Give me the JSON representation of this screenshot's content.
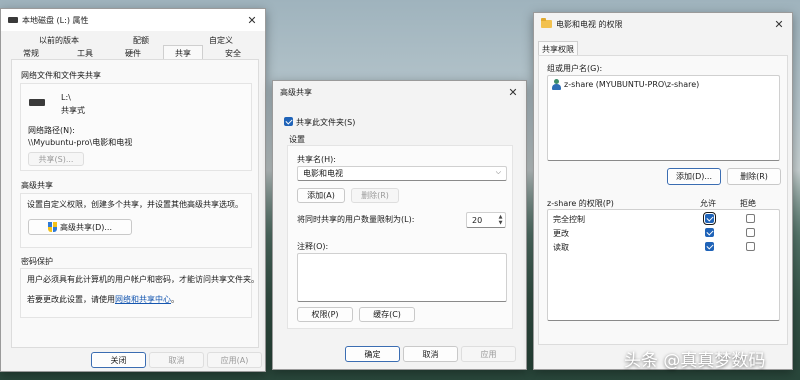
{
  "props": {
    "title": "本地磁盘 (L:) 属性",
    "tabs_top": [
      "以前的版本",
      "配额",
      "自定义"
    ],
    "tabs_bottom": [
      "常规",
      "工具",
      "硬件",
      "共享",
      "安全"
    ],
    "net_share_heading": "网络文件和文件夹共享",
    "drive_name": "L:\\",
    "drive_state": "共享式",
    "net_path_label": "网络路径(N):",
    "net_path_value": "\\\\Myubuntu-pro\\电影和电视",
    "share_button": "共享(S)...",
    "adv_heading": "高级共享",
    "adv_desc": "设置自定义权限，创建多个共享，并设置其他高级共享选项。",
    "adv_button": "高级共享(D)...",
    "pwd_heading": "密码保护",
    "pwd_desc": "用户必须具有此计算机的用户帐户和密码，才能访问共享文件夹。",
    "pwd_change_prefix": "若要更改此设置，请使用",
    "pwd_link": "网络和共享中心",
    "pwd_change_suffix": "。",
    "close_button": "关闭",
    "cancel_button": "取消",
    "apply_button": "应用(A)"
  },
  "adv": {
    "title": "高级共享",
    "share_check_label": "共享此文件夹(S)",
    "settings_label": "设置",
    "share_name_label": "共享名(H):",
    "share_name_value": "电影和电视",
    "add_button": "添加(A)",
    "remove_button": "删除(R)",
    "limit_label": "将同时共享的用户数量限制为(L):",
    "limit_value": "20",
    "comment_label": "注释(O):",
    "comment_value": "",
    "perm_button": "权限(P)",
    "cache_button": "缓存(C)",
    "ok_button": "确定",
    "cancel_button": "取消",
    "apply_button": "应用"
  },
  "perm": {
    "title": "电影和电视 的权限",
    "tab": "共享权限",
    "group_label": "组或用户名(G):",
    "users": [
      "z-share (MYUBUNTU-PRO\\z-share)"
    ],
    "add_button": "添加(D)...",
    "remove_button": "删除(R)",
    "perm_for_label": "z-share 的权限(P)",
    "allow_header": "允许",
    "deny_header": "拒绝",
    "rows": [
      {
        "name": "完全控制",
        "allow": true,
        "deny": false
      },
      {
        "name": "更改",
        "allow": true,
        "deny": false
      },
      {
        "name": "读取",
        "allow": true,
        "deny": false
      }
    ]
  },
  "watermark": "头条 @真真梦数码",
  "colors": {
    "accent": "#1f63b8",
    "link": "#1657b0"
  }
}
